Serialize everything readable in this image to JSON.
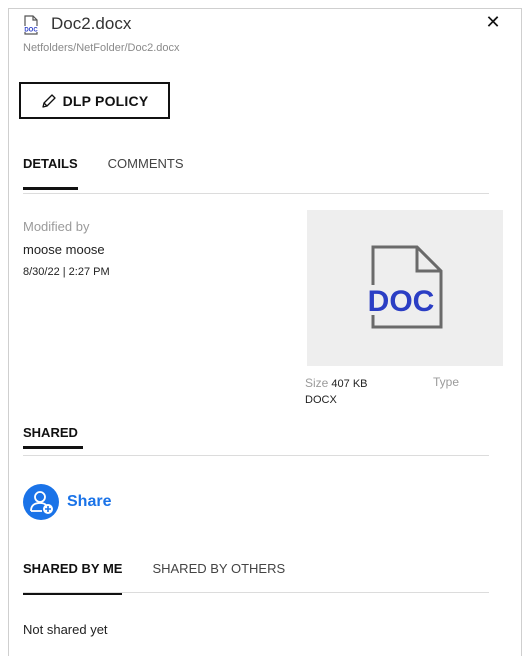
{
  "header": {
    "title": "Doc2.docx",
    "path": "Netfolders/NetFolder/Doc2.docx",
    "file_icon": "doc-file-icon",
    "close_glyph": "✕"
  },
  "dlp": {
    "label": "DLP POLICY",
    "icon": "pencil-icon"
  },
  "tabs": [
    {
      "label": "DETAILS",
      "active": true
    },
    {
      "label": "COMMENTS",
      "active": false
    }
  ],
  "details": {
    "modified_by_label": "Modified by",
    "modified_by_user": "moose moose",
    "modified_date": "8/30/22 | 2:27 PM",
    "thumbnail_text": "DOC",
    "size_label": "Size",
    "size_value": "407 KB",
    "type_label": "Type",
    "type_value": "DOCX"
  },
  "shared": {
    "heading": "SHARED",
    "share_label": "Share",
    "share_icon": "add-user-icon",
    "tabs": [
      {
        "label": "SHARED BY ME",
        "active": true
      },
      {
        "label": "SHARED BY OTHERS",
        "active": false
      }
    ],
    "empty_text": "Not shared yet"
  },
  "colors": {
    "accent": "#1a73e8",
    "doc_blue": "#2b3ec4",
    "thumb_bg": "#eeeeee"
  }
}
